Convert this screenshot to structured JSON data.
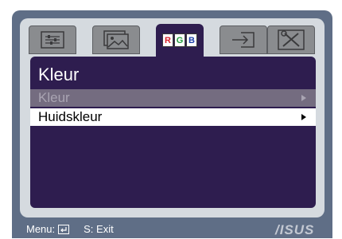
{
  "tabs": [
    {
      "icon": "image-settings-icon"
    },
    {
      "icon": "picture-icon"
    },
    {
      "icon": "rgb-icon",
      "letters": [
        "R",
        "G",
        "B"
      ],
      "active": true
    },
    {
      "icon": "input-source-icon"
    },
    {
      "icon": "tools-icon"
    }
  ],
  "panel": {
    "title": "Kleur",
    "items": [
      {
        "label": "Kleur",
        "state": "disabled"
      },
      {
        "label": "Huidskleur",
        "state": "selected"
      }
    ]
  },
  "footer": {
    "menu_label": "Menu:",
    "exit_label": "S: Exit",
    "logo": "/ISUS"
  },
  "colors": {
    "osd_background": "#5f6e86",
    "panel_background": "#2e1d4f",
    "rgb_red": "#d8232a",
    "rgb_green": "#1f9a3a",
    "rgb_blue": "#1c3fa8"
  }
}
